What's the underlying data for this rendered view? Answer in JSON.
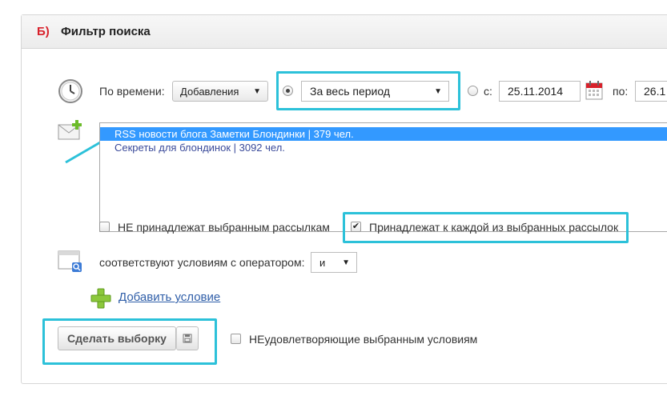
{
  "panel": {
    "letter": "Б)",
    "title": "Фильтр поиска"
  },
  "time_filter": {
    "label": "По времени:",
    "type_select": "Добавления",
    "period_select": "За весь период",
    "from_label": "с:",
    "from_date": "25.11.2014",
    "to_label": "по:",
    "to_date": "26.1"
  },
  "mailings": {
    "items": [
      {
        "label": "RSS новости блога Заметки Блондинки | 379 чел.",
        "selected": true
      },
      {
        "label": "Секреты для блондинок | 3092 чел.",
        "selected": false
      }
    ],
    "not_belong_label": "НЕ принадлежат выбранным рассылкам",
    "belong_each_label": "Принадлежат к каждой из выбранных рассылок"
  },
  "conditions": {
    "label": "соответствуют условиям с оператором:",
    "operator": "и",
    "add_link": "Добавить условие"
  },
  "actions": {
    "submit_label": "Сделать выборку",
    "not_satisfy_label": "НЕудовлетворяющие выбранным условиям"
  },
  "colors": {
    "highlight": "#2cc1d9",
    "accent_red": "#d8212b",
    "selection": "#3399ff",
    "link": "#2f5ea8"
  },
  "icons": [
    "clock-icon",
    "calendar-icon",
    "mail-add-icon",
    "filter-window-icon",
    "plus-icon",
    "save-icon"
  ]
}
